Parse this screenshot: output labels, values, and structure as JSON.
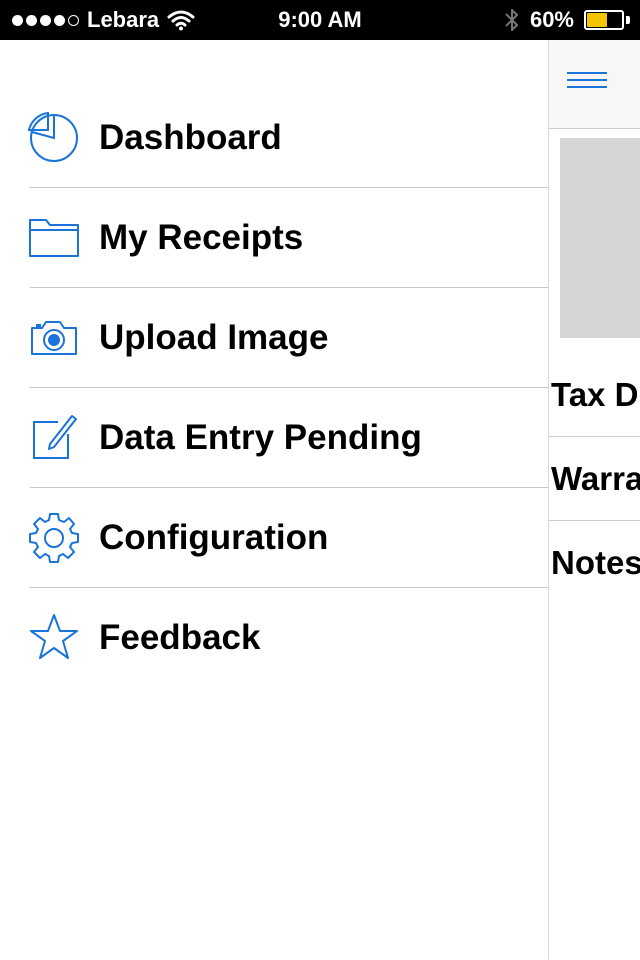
{
  "status_bar": {
    "carrier": "Lebara",
    "time": "9:00 AM",
    "battery_percent": "60%",
    "battery_level": 0.6,
    "signal_bars_filled": 4,
    "signal_bars_total": 5,
    "battery_color": "#f5c400",
    "icons": [
      "wifi-icon",
      "bluetooth-icon",
      "battery-icon"
    ]
  },
  "menu": {
    "accent_color": "#1a73d9",
    "items": [
      {
        "label": "Dashboard",
        "icon": "pie-chart-icon"
      },
      {
        "label": "My Receipts",
        "icon": "folder-icon"
      },
      {
        "label": "Upload Image",
        "icon": "camera-icon"
      },
      {
        "label": "Data Entry Pending",
        "icon": "edit-icon"
      },
      {
        "label": "Configuration",
        "icon": "gear-icon"
      },
      {
        "label": "Feedback",
        "icon": "star-icon"
      }
    ]
  },
  "content": {
    "nav_icon": "hamburger-menu-icon",
    "fields": [
      {
        "label": "Tax D"
      },
      {
        "label": "Warra"
      },
      {
        "label": "Notes"
      }
    ]
  }
}
